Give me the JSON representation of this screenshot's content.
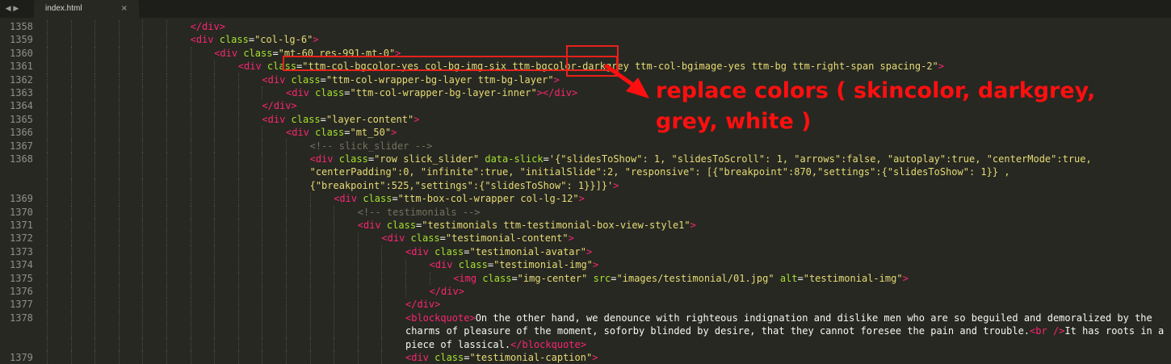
{
  "tab": {
    "filename": "index.html",
    "close_glyph": "×",
    "nav_glyph": "◀ ▶"
  },
  "line_numbers": [
    "1358",
    "1359",
    "1360",
    "1361",
    "1362",
    "1363",
    "1364",
    "1365",
    "1366",
    "1367",
    "1368",
    "1369",
    "1370",
    "1371",
    "1372",
    "1373",
    "1374",
    "1375",
    "1376",
    "1377",
    "1378",
    "1379"
  ],
  "code_lines": [
    {
      "n": "1358",
      "indent": 6,
      "tokens": [
        [
          "t",
          "</div>"
        ]
      ]
    },
    {
      "n": "1359",
      "indent": 6,
      "tokens": [
        [
          "t",
          "<div "
        ],
        [
          "a",
          "class"
        ],
        [
          "p",
          "="
        ],
        [
          "s",
          "\"col-lg-6\""
        ],
        [
          "t",
          ">"
        ]
      ]
    },
    {
      "n": "1360",
      "indent": 7,
      "tokens": [
        [
          "t",
          "<div "
        ],
        [
          "a",
          "class"
        ],
        [
          "p",
          "="
        ],
        [
          "s",
          "\"mt-60 res-991-mt-0\""
        ],
        [
          "t",
          ">"
        ]
      ]
    },
    {
      "n": "1361",
      "indent": 8,
      "tokens": [
        [
          "t",
          "<div "
        ],
        [
          "a",
          "class"
        ],
        [
          "p",
          "="
        ],
        [
          "s",
          "\"ttm-col-bgcolor-yes col-bg-img-six ttm-bgcolor-darkgrey ttm-col-bgimage-yes ttm-bg ttm-right-span spacing-2\""
        ],
        [
          "t",
          ">"
        ]
      ]
    },
    {
      "n": "1362",
      "indent": 9,
      "tokens": [
        [
          "t",
          "<div "
        ],
        [
          "a",
          "class"
        ],
        [
          "p",
          "="
        ],
        [
          "s",
          "\"ttm-col-wrapper-bg-layer ttm-bg-layer\""
        ],
        [
          "t",
          ">"
        ]
      ]
    },
    {
      "n": "1363",
      "indent": 10,
      "tokens": [
        [
          "t",
          "<div "
        ],
        [
          "a",
          "class"
        ],
        [
          "p",
          "="
        ],
        [
          "s",
          "\"ttm-col-wrapper-bg-layer-inner\""
        ],
        [
          "t",
          "></div>"
        ]
      ]
    },
    {
      "n": "1364",
      "indent": 9,
      "tokens": [
        [
          "t",
          "</div>"
        ]
      ]
    },
    {
      "n": "1365",
      "indent": 9,
      "tokens": [
        [
          "t",
          "<div "
        ],
        [
          "a",
          "class"
        ],
        [
          "p",
          "="
        ],
        [
          "s",
          "\"layer-content\""
        ],
        [
          "t",
          ">"
        ]
      ]
    },
    {
      "n": "1366",
      "indent": 10,
      "tokens": [
        [
          "t",
          "<div "
        ],
        [
          "a",
          "class"
        ],
        [
          "p",
          "="
        ],
        [
          "s",
          "\"mt_50\""
        ],
        [
          "t",
          ">"
        ]
      ]
    },
    {
      "n": "1367",
      "indent": 11,
      "tokens": [
        [
          "c",
          "<!-- slick_slider -->"
        ]
      ]
    },
    {
      "n": "1368",
      "indent": 11,
      "tokens": [
        [
          "t",
          "<div "
        ],
        [
          "a",
          "class"
        ],
        [
          "p",
          "="
        ],
        [
          "s",
          "\"row slick_slider\" "
        ],
        [
          "a",
          "data-slick"
        ],
        [
          "p",
          "="
        ],
        [
          "s",
          "'{\"slidesToShow\": 1, \"slidesToScroll\": 1, \"arrows\":false, \"autoplay\":true, \"centerMode\":true,"
        ]
      ]
    },
    {
      "n": "",
      "indent": 11,
      "tokens": [
        [
          "s",
          "\"centerPadding\":0, \"infinite\":true, \"initialSlide\":2, \"responsive\": [{\"breakpoint\":870,\"settings\":{\"slidesToShow\": 1}} ,"
        ]
      ]
    },
    {
      "n": "",
      "indent": 11,
      "tokens": [
        [
          "s",
          "{\"breakpoint\":525,\"settings\":{\"slidesToShow\": 1}}]}'"
        ],
        [
          "t",
          ">"
        ]
      ]
    },
    {
      "n": "1369",
      "indent": 12,
      "tokens": [
        [
          "t",
          "<div "
        ],
        [
          "a",
          "class"
        ],
        [
          "p",
          "="
        ],
        [
          "s",
          "\"ttm-box-col-wrapper col-lg-12\""
        ],
        [
          "t",
          ">"
        ]
      ]
    },
    {
      "n": "1370",
      "indent": 13,
      "tokens": [
        [
          "c",
          "<!-- testimonials -->"
        ]
      ]
    },
    {
      "n": "1371",
      "indent": 13,
      "tokens": [
        [
          "t",
          "<div "
        ],
        [
          "a",
          "class"
        ],
        [
          "p",
          "="
        ],
        [
          "s",
          "\"testimonials ttm-testimonial-box-view-style1\""
        ],
        [
          "t",
          ">"
        ]
      ]
    },
    {
      "n": "1372",
      "indent": 14,
      "tokens": [
        [
          "t",
          "<div "
        ],
        [
          "a",
          "class"
        ],
        [
          "p",
          "="
        ],
        [
          "s",
          "\"testimonial-content\""
        ],
        [
          "t",
          ">"
        ]
      ]
    },
    {
      "n": "1373",
      "indent": 15,
      "tokens": [
        [
          "t",
          "<div "
        ],
        [
          "a",
          "class"
        ],
        [
          "p",
          "="
        ],
        [
          "s",
          "\"testimonial-avatar\""
        ],
        [
          "t",
          ">"
        ]
      ]
    },
    {
      "n": "1374",
      "indent": 16,
      "tokens": [
        [
          "t",
          "<div "
        ],
        [
          "a",
          "class"
        ],
        [
          "p",
          "="
        ],
        [
          "s",
          "\"testimonial-img\""
        ],
        [
          "t",
          ">"
        ]
      ]
    },
    {
      "n": "1375",
      "indent": 17,
      "tokens": [
        [
          "t",
          "<img "
        ],
        [
          "a",
          "class"
        ],
        [
          "p",
          "="
        ],
        [
          "s",
          "\"img-center\" "
        ],
        [
          "a",
          "src"
        ],
        [
          "p",
          "="
        ],
        [
          "s",
          "\"images/testimonial/01.jpg\" "
        ],
        [
          "a",
          "alt"
        ],
        [
          "p",
          "="
        ],
        [
          "s",
          "\"testimonial-img\""
        ],
        [
          "t",
          ">"
        ]
      ]
    },
    {
      "n": "1376",
      "indent": 16,
      "tokens": [
        [
          "t",
          "</div>"
        ]
      ]
    },
    {
      "n": "1377",
      "indent": 15,
      "tokens": [
        [
          "t",
          "</div>"
        ]
      ]
    },
    {
      "n": "1378",
      "indent": 15,
      "tokens": [
        [
          "t",
          "<blockquote>"
        ],
        [
          "p",
          "On the other hand, we denounce with righteous indignation and dislike men who are so beguiled and demoralized by the"
        ]
      ]
    },
    {
      "n": "",
      "indent": 15,
      "tokens": [
        [
          "p",
          "charms of pleasure of the moment, soforby blinded by desire, that they cannot foresee the pain and trouble."
        ],
        [
          "t",
          "<br />"
        ],
        [
          "p",
          "It has roots in a"
        ]
      ]
    },
    {
      "n": "",
      "indent": 15,
      "tokens": [
        [
          "p",
          "piece of lassical."
        ],
        [
          "t",
          "</blockquote>"
        ]
      ]
    },
    {
      "n": "1379",
      "indent": 15,
      "tokens": [
        [
          "t",
          "<div "
        ],
        [
          "a",
          "class"
        ],
        [
          "p",
          "="
        ],
        [
          "s",
          "\"testimonial-caption\""
        ],
        [
          "t",
          ">"
        ]
      ]
    }
  ],
  "annotation": {
    "line1": "replace colors ( skincolor, darkgrey,",
    "line2": "grey, white )",
    "color": "#ff0f0f"
  },
  "colors": {
    "background": "#272822",
    "tag": "#f92672",
    "attribute": "#a6e22e",
    "string": "#e6db74",
    "comment": "#75715e",
    "text": "#f8f8f2",
    "line_number": "#8f908a",
    "highlight": "#e8211a"
  }
}
